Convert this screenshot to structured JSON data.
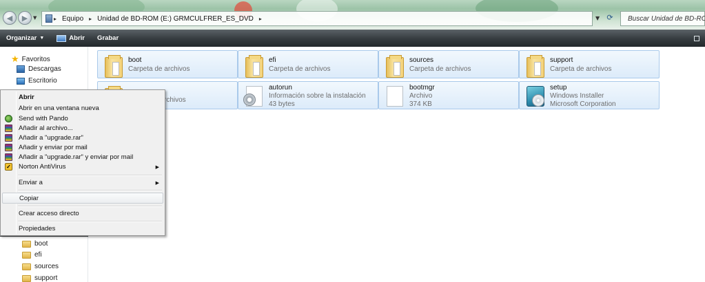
{
  "address": {
    "breadcrumbs": [
      "Equipo",
      "Unidad de BD-ROM (E:) GRMCULFRER_ES_DVD"
    ],
    "search_placeholder": "Buscar Unidad de BD-ROM"
  },
  "toolbar": {
    "organize": "Organizar",
    "open": "Abrir",
    "burn": "Grabar"
  },
  "nav": {
    "favorites": "Favoritos",
    "downloads": "Descargas",
    "desktop": "Escritorio",
    "tree": [
      "boot",
      "efi",
      "sources",
      "support"
    ]
  },
  "files": [
    {
      "name": "boot",
      "line1": "Carpeta de archivos",
      "line2": "",
      "icon": "folder-icon"
    },
    {
      "name": "efi",
      "line1": "Carpeta de archivos",
      "line2": "",
      "icon": "folder-icon"
    },
    {
      "name": "sources",
      "line1": "Carpeta de archivos",
      "line2": "",
      "icon": "folder-icon"
    },
    {
      "name": "support",
      "line1": "Carpeta de archivos",
      "line2": "",
      "icon": "folder-icon"
    },
    {
      "name": "",
      "line1": "rchivos",
      "line2": "",
      "icon": "folder-icon"
    },
    {
      "name": "autorun",
      "line1": "Información sobre la instalación",
      "line2": "43 bytes",
      "icon": "setup-info-icon"
    },
    {
      "name": "bootmgr",
      "line1": "Archivo",
      "line2": "374 KB",
      "icon": "file-icon"
    },
    {
      "name": "setup",
      "line1": "Windows Installer",
      "line2": "Microsoft Corporation",
      "icon": "installer-icon"
    }
  ],
  "context_menu": {
    "items": [
      {
        "label": "Abrir",
        "bold": true
      },
      {
        "label": "Abrir en una ventana nueva"
      },
      {
        "label": "Send with Pando",
        "icon": "pando-icon"
      },
      {
        "label": "Añadir al archivo...",
        "icon": "winrar-icon"
      },
      {
        "label": "Añadir a \"upgrade.rar\"",
        "icon": "winrar-icon"
      },
      {
        "label": "Añadir y enviar por mail",
        "icon": "winrar-icon"
      },
      {
        "label": "Añadir a \"upgrade.rar\" y enviar por mail",
        "icon": "winrar-icon"
      },
      {
        "label": "Norton AntiVirus",
        "icon": "norton-icon",
        "submenu": true
      },
      {
        "label": "Enviar a",
        "submenu": true
      },
      {
        "label": "Copiar",
        "highlighted": true
      },
      {
        "label": "Crear acceso directo"
      },
      {
        "label": "Propiedades"
      }
    ]
  },
  "colors": {
    "command_bar": "#383e42",
    "tile_border": "#a9c9ea",
    "tile_fill": "#dcebfa",
    "menu_bg": "#f0f0f0"
  }
}
